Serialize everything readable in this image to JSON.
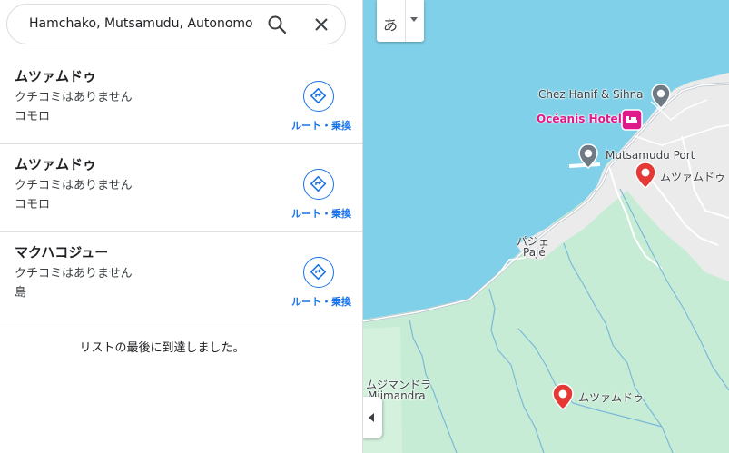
{
  "search": {
    "query": "Hamchako, Mutsamudu, Autonomous",
    "search_icon": "search-icon",
    "close_icon": "close-icon"
  },
  "results": [
    {
      "name": "ムツァムドゥ",
      "reviews": "クチコミはありません",
      "category": "コモロ",
      "route_label": "ルート・乗換"
    },
    {
      "name": "ムツァムドゥ",
      "reviews": "クチコミはありません",
      "category": "コモロ",
      "route_label": "ルート・乗換"
    },
    {
      "name": "マクハコジュー",
      "reviews": "クチコミはありません",
      "category": "島",
      "route_label": "ルート・乗換"
    }
  ],
  "end_of_list": "リストの最後に到達しました。",
  "map": {
    "language_button": "あ",
    "labels": {
      "chez_hanif": "Chez Hanif & Sihna",
      "oceanis": "Océanis Hotel",
      "port": "Mutsamudu Port",
      "mutsamudu_pin1": "ムツァムドゥ",
      "paje_jp": "パジェ",
      "paje": "Pajé",
      "mjimandra_jp": "ムジマンドラ",
      "mjimandra": "Mjimandra",
      "mutsamudu_pin2": "ムツァムドゥ"
    }
  },
  "colors": {
    "accent": "#1a73e8",
    "water": "#7fd0e8",
    "land": "#c7ecd5",
    "urban": "#ecebec",
    "hotel_pink": "#e0198a",
    "pin_red": "#e53935"
  }
}
